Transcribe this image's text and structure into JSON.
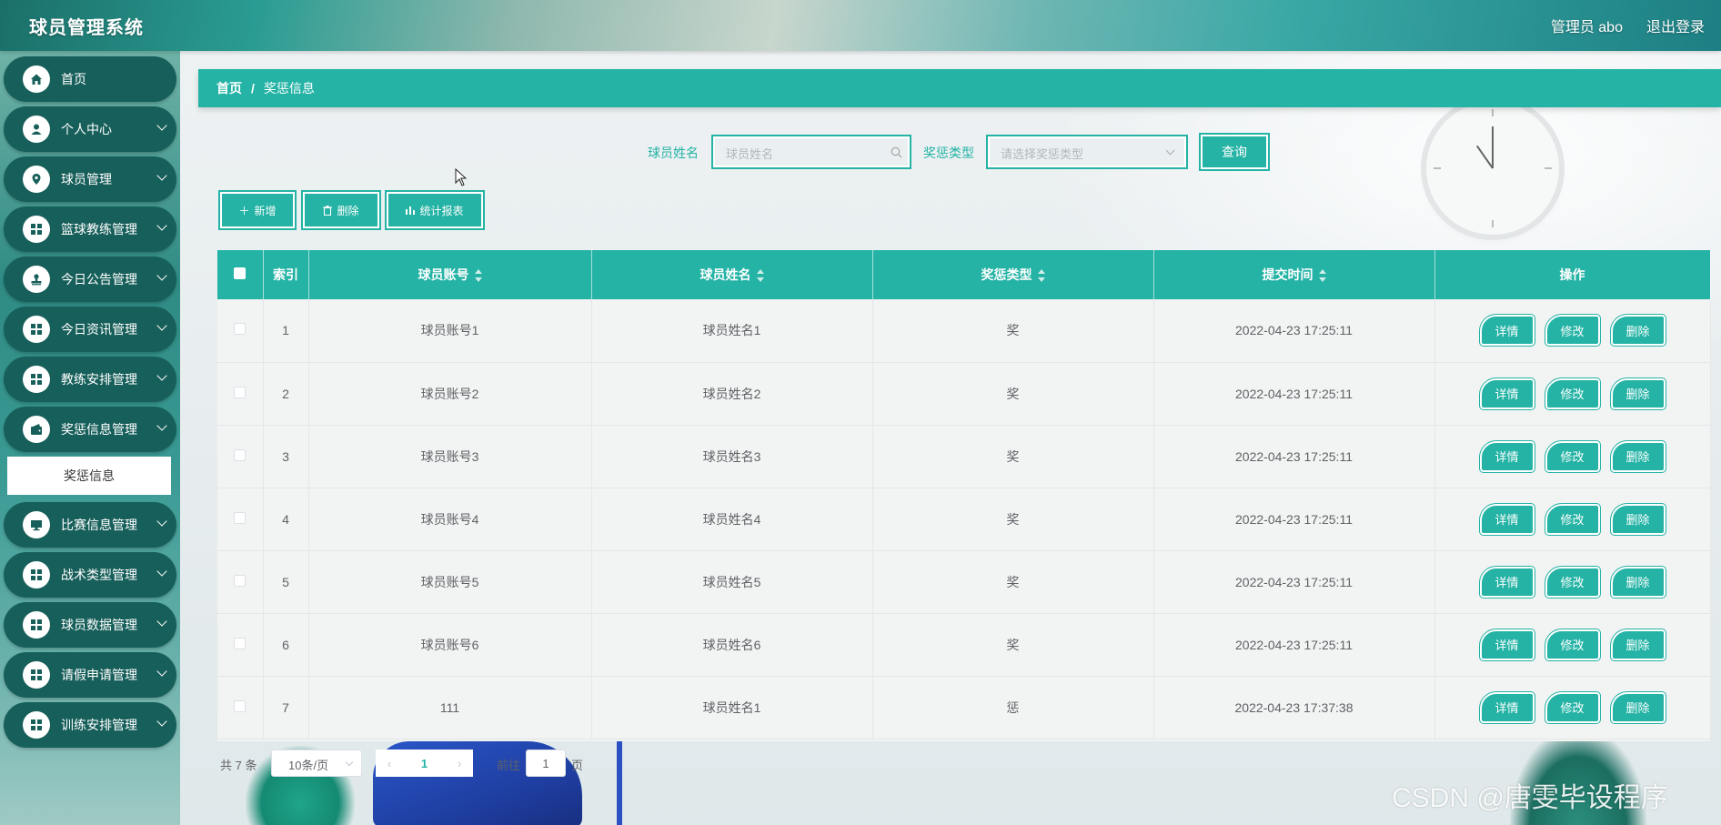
{
  "header": {
    "title": "球员管理系统",
    "user_label": "管理员 abo",
    "logout_label": "退出登录"
  },
  "sidebar": {
    "items": [
      {
        "label": "首页",
        "icon": "home-icon",
        "has_children": false
      },
      {
        "label": "个人中心",
        "icon": "user-icon",
        "has_children": true
      },
      {
        "label": "球员管理",
        "icon": "location-icon",
        "has_children": true
      },
      {
        "label": "篮球教练管理",
        "icon": "grid-icon",
        "has_children": true
      },
      {
        "label": "今日公告管理",
        "icon": "stamp-icon",
        "has_children": true
      },
      {
        "label": "今日资讯管理",
        "icon": "grid-icon",
        "has_children": true
      },
      {
        "label": "教练安排管理",
        "icon": "grid-icon",
        "has_children": true
      },
      {
        "label": "奖惩信息管理",
        "icon": "wallet-icon",
        "has_children": true
      },
      {
        "label": "比赛信息管理",
        "icon": "monitor-icon",
        "has_children": true
      },
      {
        "label": "战术类型管理",
        "icon": "grid-icon",
        "has_children": true
      },
      {
        "label": "球员数据管理",
        "icon": "grid-icon",
        "has_children": true
      },
      {
        "label": "请假申请管理",
        "icon": "grid-icon",
        "has_children": true
      },
      {
        "label": "训练安排管理",
        "icon": "grid-icon",
        "has_children": true
      }
    ],
    "active_submenu": "奖惩信息"
  },
  "breadcrumb": {
    "home": "首页",
    "separator": "/",
    "current": "奖惩信息"
  },
  "search": {
    "name_label": "球员姓名",
    "name_placeholder": "球员姓名",
    "type_label": "奖惩类型",
    "type_placeholder": "请选择奖惩类型",
    "query_label": "查询"
  },
  "actions": {
    "add_label": "新增",
    "delete_label": "删除",
    "report_label": "统计报表"
  },
  "table": {
    "headers": {
      "index": "索引",
      "account": "球员账号",
      "name": "球员姓名",
      "type": "奖惩类型",
      "time": "提交时间",
      "ops": "操作"
    },
    "rows": [
      {
        "index": "1",
        "account": "球员账号1",
        "name": "球员姓名1",
        "type": "奖",
        "time": "2022-04-23 17:25:11"
      },
      {
        "index": "2",
        "account": "球员账号2",
        "name": "球员姓名2",
        "type": "奖",
        "time": "2022-04-23 17:25:11"
      },
      {
        "index": "3",
        "account": "球员账号3",
        "name": "球员姓名3",
        "type": "奖",
        "time": "2022-04-23 17:25:11"
      },
      {
        "index": "4",
        "account": "球员账号4",
        "name": "球员姓名4",
        "type": "奖",
        "time": "2022-04-23 17:25:11"
      },
      {
        "index": "5",
        "account": "球员账号5",
        "name": "球员姓名5",
        "type": "奖",
        "time": "2022-04-23 17:25:11"
      },
      {
        "index": "6",
        "account": "球员账号6",
        "name": "球员姓名6",
        "type": "奖",
        "time": "2022-04-23 17:25:11"
      },
      {
        "index": "7",
        "account": "111",
        "name": "球员姓名1",
        "type": "惩",
        "time": "2022-04-23 17:37:38"
      }
    ],
    "row_buttons": {
      "detail": "详情",
      "edit": "修改",
      "delete": "删除"
    }
  },
  "pagination": {
    "total": "共 7 条",
    "page_size": "10条/页",
    "current_page": "1",
    "goto_label": "前往",
    "goto_value": "1",
    "goto_unit": "页"
  },
  "watermark": "CSDN @唐雯毕设程序",
  "colors": {
    "accent": "#24b3a5",
    "sidebar_item": "#175f5a"
  }
}
